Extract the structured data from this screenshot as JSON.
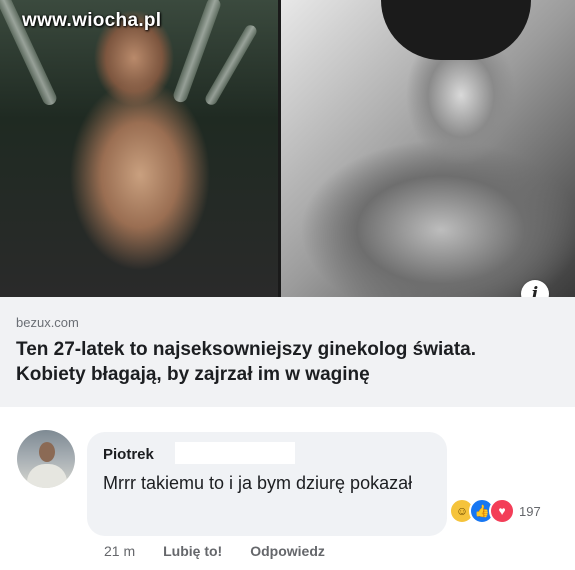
{
  "watermark": "www.wiocha.pl",
  "link_preview": {
    "domain": "bezux.com",
    "title": "Ten 27-latek to najseksowniejszy ginekolog świata. Kobiety błagają, by zajrzał im w waginę",
    "info_icon": "info-icon"
  },
  "comment": {
    "author": "Piotrek",
    "text": "Mrrr takiemu to i ja bym dziurę pokazał",
    "reactions": {
      "icons": [
        "haha-icon",
        "like-icon",
        "love-icon"
      ],
      "count": "197"
    },
    "time": "21 m",
    "like_label": "Lubię to!",
    "reply_label": "Odpowiedz"
  },
  "colors": {
    "like_blue": "#1877f2",
    "love_red": "#f33e58",
    "haha_yellow": "#f5c33b",
    "bubble_bg": "#f0f2f5",
    "link_card_bg": "#f1f2f4"
  }
}
